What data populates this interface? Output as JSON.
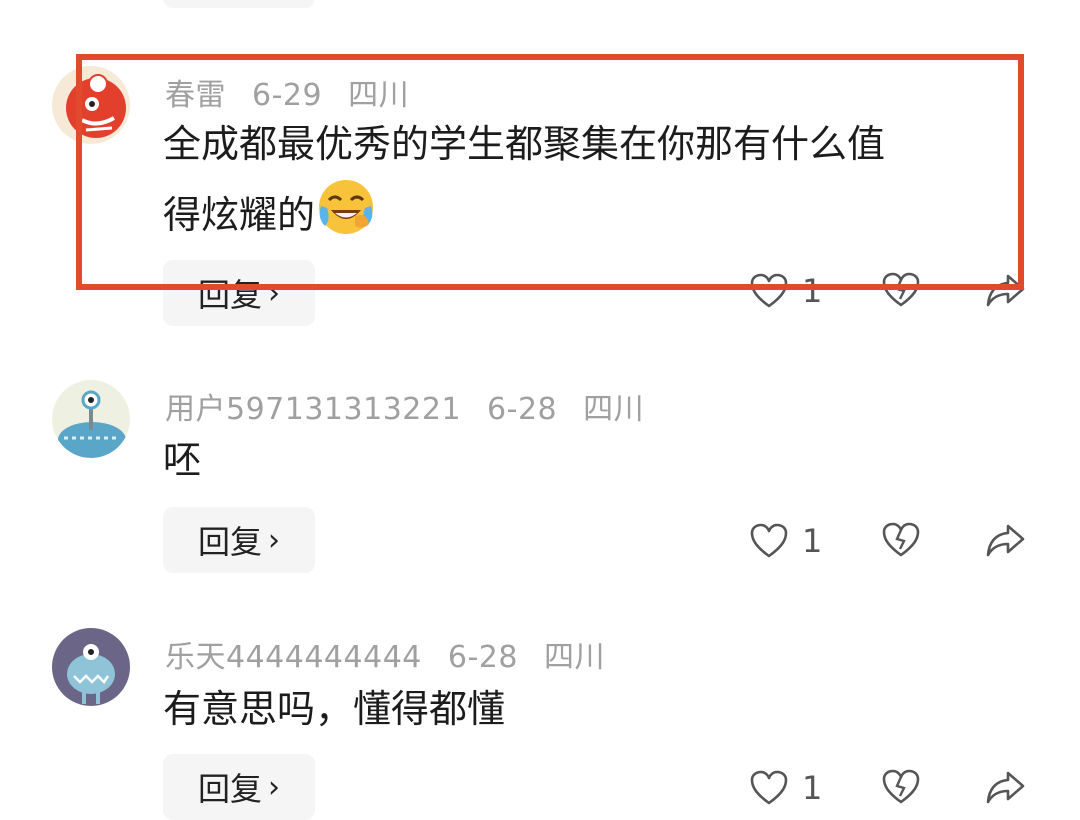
{
  "comments": [
    {
      "username": "春雷",
      "date": "6-29",
      "location": "四川",
      "text_line1": "全成都最优秀的学生都聚集在你那有什么值",
      "text_line2": "得炫耀的",
      "emoji_icon": "laughing-crying-emoji",
      "reply_label": "回复",
      "likes": "1",
      "highlighted": true
    },
    {
      "username": "用户597131313221",
      "date": "6-28",
      "location": "四川",
      "text": "呸",
      "reply_label": "回复",
      "likes": "1"
    },
    {
      "username": "乐天4444444444",
      "date": "6-28",
      "location": "四川",
      "text": "有意思吗，懂得都懂",
      "reply_label": "回复",
      "likes": "1"
    }
  ],
  "colors": {
    "highlight_border": "#e24a2e",
    "meta_text": "#a0a0a0",
    "reply_bg": "#f5f5f5"
  },
  "icons": {
    "chevron": "chevron-right-icon",
    "like": "heart-outline-icon",
    "dislike": "broken-heart-icon",
    "share": "share-arrow-icon"
  }
}
